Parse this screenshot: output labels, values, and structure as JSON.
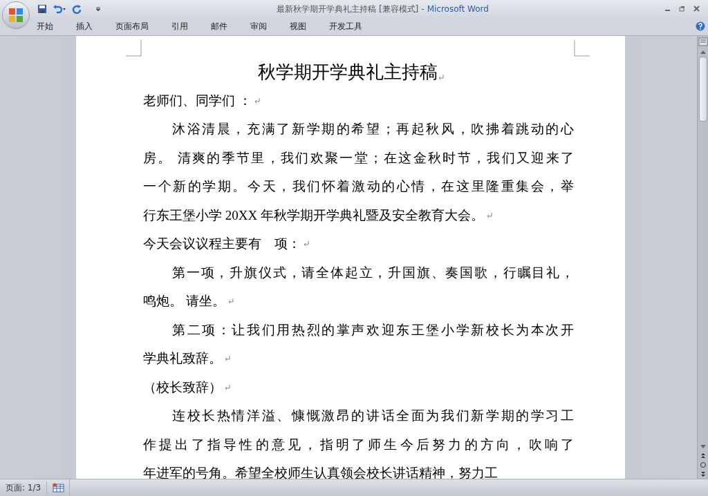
{
  "window": {
    "title": "最新秋学期开学典礼主持稿 [兼容模式]",
    "separator": "-",
    "app_name": "Microsoft Word"
  },
  "ribbon_tabs": [
    {
      "label": "开始"
    },
    {
      "label": "插入"
    },
    {
      "label": "页面布局"
    },
    {
      "label": "引用"
    },
    {
      "label": "邮件"
    },
    {
      "label": "审阅"
    },
    {
      "label": "视图"
    },
    {
      "label": "开发工具"
    }
  ],
  "document": {
    "title": "秋学期开学典礼主持稿",
    "paragraphs": [
      {
        "indent": false,
        "mark": true,
        "lines": [
          "老师们、同学们 ："
        ]
      },
      {
        "indent": true,
        "mark": true,
        "lines": [
          "沐浴清晨，充满了新学期的希望；再起秋风，吹拂着跳动的心",
          "房。 清爽的季节里，我们欢聚一堂；在这金秋时节，我们又迎来了",
          "一个新的学期。今天，我们怀着激动的心情，在这里隆重集会，举",
          "行东王堡小学 20XX 年秋学期开学典礼暨及安全教育大会。"
        ]
      },
      {
        "indent": false,
        "mark": true,
        "lines": [
          "今天会议议程主要有    项："
        ]
      },
      {
        "indent": true,
        "mark": true,
        "lines": [
          "第一项，升旗仪式，请全体起立，升国旗、奏国歌，行瞩目礼，",
          "鸣炮。 请坐。"
        ]
      },
      {
        "indent": true,
        "mark": true,
        "lines": [
          "第二项：让我们用热烈的掌声欢迎东王堡小学新校长为本次开",
          "学典礼致辞。"
        ]
      },
      {
        "indent": false,
        "mark": true,
        "lines": [
          "（校长致辞）"
        ]
      },
      {
        "indent": true,
        "mark": false,
        "lines": [
          "连校长热情洋溢、慷慨激昂的讲话全面为我们新学期的学习工",
          "作提出了指导性的意见，指明了师生今后努力的方向，吹响了",
          "年进军的号角。希望全校师生认真领会校长讲话精神，努力工"
        ]
      }
    ]
  },
  "status_bar": {
    "page": "页面: 1/3"
  }
}
